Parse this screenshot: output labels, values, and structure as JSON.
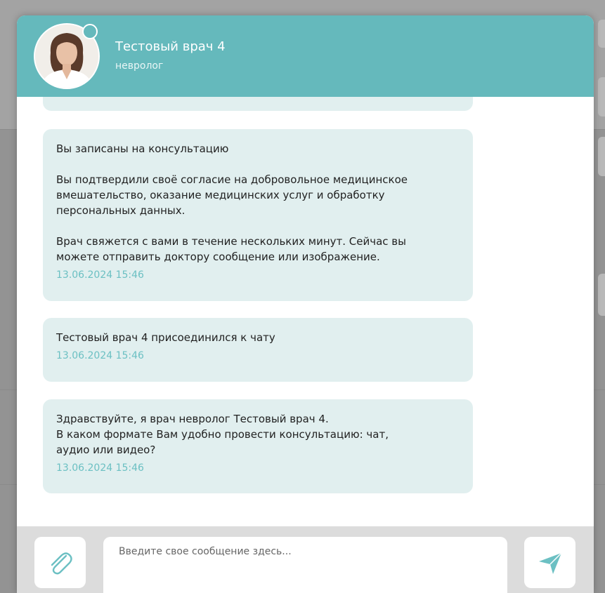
{
  "header": {
    "doctor_name": "Тестовый врач 4",
    "specialty": "невролог"
  },
  "messages": [
    {
      "lines": [
        "Вы записаны на консультацию",
        "",
        "Вы подтвердили своё согласие на добровольное медицинское",
        "вмешательство, оказание медицинских услуг и обработку",
        "персональных данных.",
        "",
        "Врач свяжется с вами в течение нескольких минут. Сейчас вы",
        "можете отправить доктору сообщение или изображение."
      ],
      "time": "13.06.2024 15:46"
    },
    {
      "lines": [
        "Тестовый врач 4 присоединился к чату"
      ],
      "time": "13.06.2024 15:46"
    },
    {
      "lines": [
        "Здравствуйте, я врач невролог Тестовый врач 4.",
        "В каком формате Вам удобно провести консультацию: чат,",
        "аудио или видео?"
      ],
      "time": "13.06.2024 15:46"
    }
  ],
  "composer": {
    "placeholder": "Введите свое сообщение здесь..."
  },
  "icons": {
    "attach": "paperclip-icon",
    "send": "send-icon"
  },
  "colors": {
    "accent": "#65b9bc",
    "bubble": "#e1efef",
    "timestamp": "#6cc0c3"
  }
}
